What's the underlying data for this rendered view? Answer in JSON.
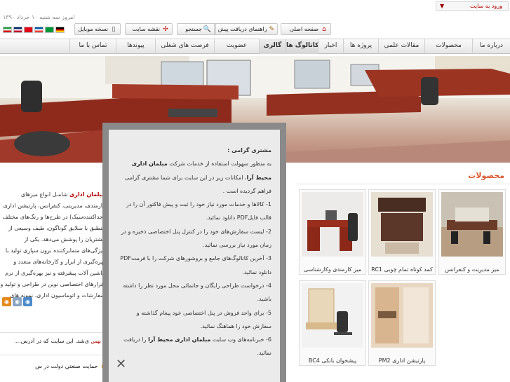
{
  "header": {
    "login_label": "ورود به سایت",
    "date": "امروز سه شنبه ۱۰ خرداد ۱۳۹۰"
  },
  "toolbar": {
    "home": "صفحه اصلی",
    "invoice_guide": "راهنمای دریافت پیش فاکتور",
    "search": "جستجو",
    "sitemap": "نقشه سایت",
    "mobile": "نسخه موبایل"
  },
  "flags": [
    {
      "name": "flag-iran",
      "colors": [
        "#239f40",
        "#ffffff",
        "#da0000"
      ]
    },
    {
      "name": "flag-uk",
      "colors": [
        "#012169",
        "#ffffff",
        "#c8102e"
      ]
    },
    {
      "name": "flag-turkey",
      "colors": [
        "#e30a17",
        "#e30a17",
        "#e30a17"
      ]
    },
    {
      "name": "flag-france",
      "colors": [
        "#0055a4",
        "#ffffff",
        "#ef4135"
      ]
    },
    {
      "name": "flag-arabic",
      "colors": [
        "#009639",
        "#009639",
        "#009639"
      ]
    },
    {
      "name": "flag-germany",
      "colors": [
        "#000000",
        "#dd0000",
        "#ffce00"
      ]
    }
  ],
  "nav": [
    "درباره ما",
    "محصولات",
    "مقالات علمی",
    "پروژه ها",
    "اخبار",
    "کاتالوگ ها",
    "گالری",
    "عضویت",
    "فرصت های شغلی",
    "پیوندها",
    "تماس با ما"
  ],
  "intro": {
    "brand": "مبلمان اداری",
    "text": "شامـل انواع میزهای کارمندی، مدیریتی، کنفرانس، پارتیشن اداری (جداکننده‌سبک) در طرح‌ها و رنگ‌های مختلف منطبق با سلایق گوناگون، طیف وسیعی از مشتریان را پوشش می‌دهد. یکی از ویژگی‌های متمایزکننده برون سپاری تولید با بهره‌گیری از ابزار و کارخانه‌های متعدد و ماشین آلات پیشرفته و نیز بهره‌گیری از نرم افزارهای اختصاصی نوین در طراحی و تولید و سفارشات و اتوماسیون اداری، نمونه های"
  },
  "news": [
    {
      "text": "ی‌شد. این سایت که در آدرس…",
      "date": "۵ بهمن"
    },
    {
      "text": "حمایت صنعتي دولت در س"
    }
  ],
  "products": {
    "title": "محصولات",
    "items": [
      {
        "caption": "میز مدیریت و کنفرانس"
      },
      {
        "caption": "کمد کوتاه تمام چوبی RC1"
      },
      {
        "caption": "میز کارمندی وکارشناسی"
      },
      {
        "caption": "پارتیشن اداری PM2"
      },
      {
        "caption": "پیشخوان بانکی BC4"
      }
    ]
  },
  "modal": {
    "greeting": "مشتری گرامی :",
    "p1_a": "به منظور سهولت استفاده از خدمات شرکت",
    "p1_brand": "مبلمان اداری محیط آرا",
    "p1_b": "، امکانات زیر در این سایت برای شما مشتری گرامی فراهم گردیده است .",
    "items": [
      "1- کالاها و خدمات مورد نیاز خود را ثبت و پیش فاکتور آن را در قالب فایلPDF دانلود نمائید.",
      "2- لیست سفارش‌های خود را در کنترل پنل اختصاصی ذخیره و در زمان مورد نیاز بررسی نمائید.",
      "3- آخرین کاتالوگ‌های جامع و بروشورهای شرکت را با فرمتPDF دانلود نمائید.",
      "4- درخواست طراحی رایگان و جانمائی محل مورد نظر را داشته باشید.",
      "5- برای واحد فروش در پنل اختصاصی خود پیغام گذاشته و سفارش خود را هماهنگ نمائید."
    ],
    "item6_a": "6- خبرنامه‌های وب سایت",
    "item6_brand": "مبلمان اداری محیط آرا",
    "item6_b": "را دریافت نمائید."
  },
  "colors": {
    "accent": "#b10000",
    "products_title": "#d9582c",
    "modal_frame": "#8a8a8a"
  }
}
